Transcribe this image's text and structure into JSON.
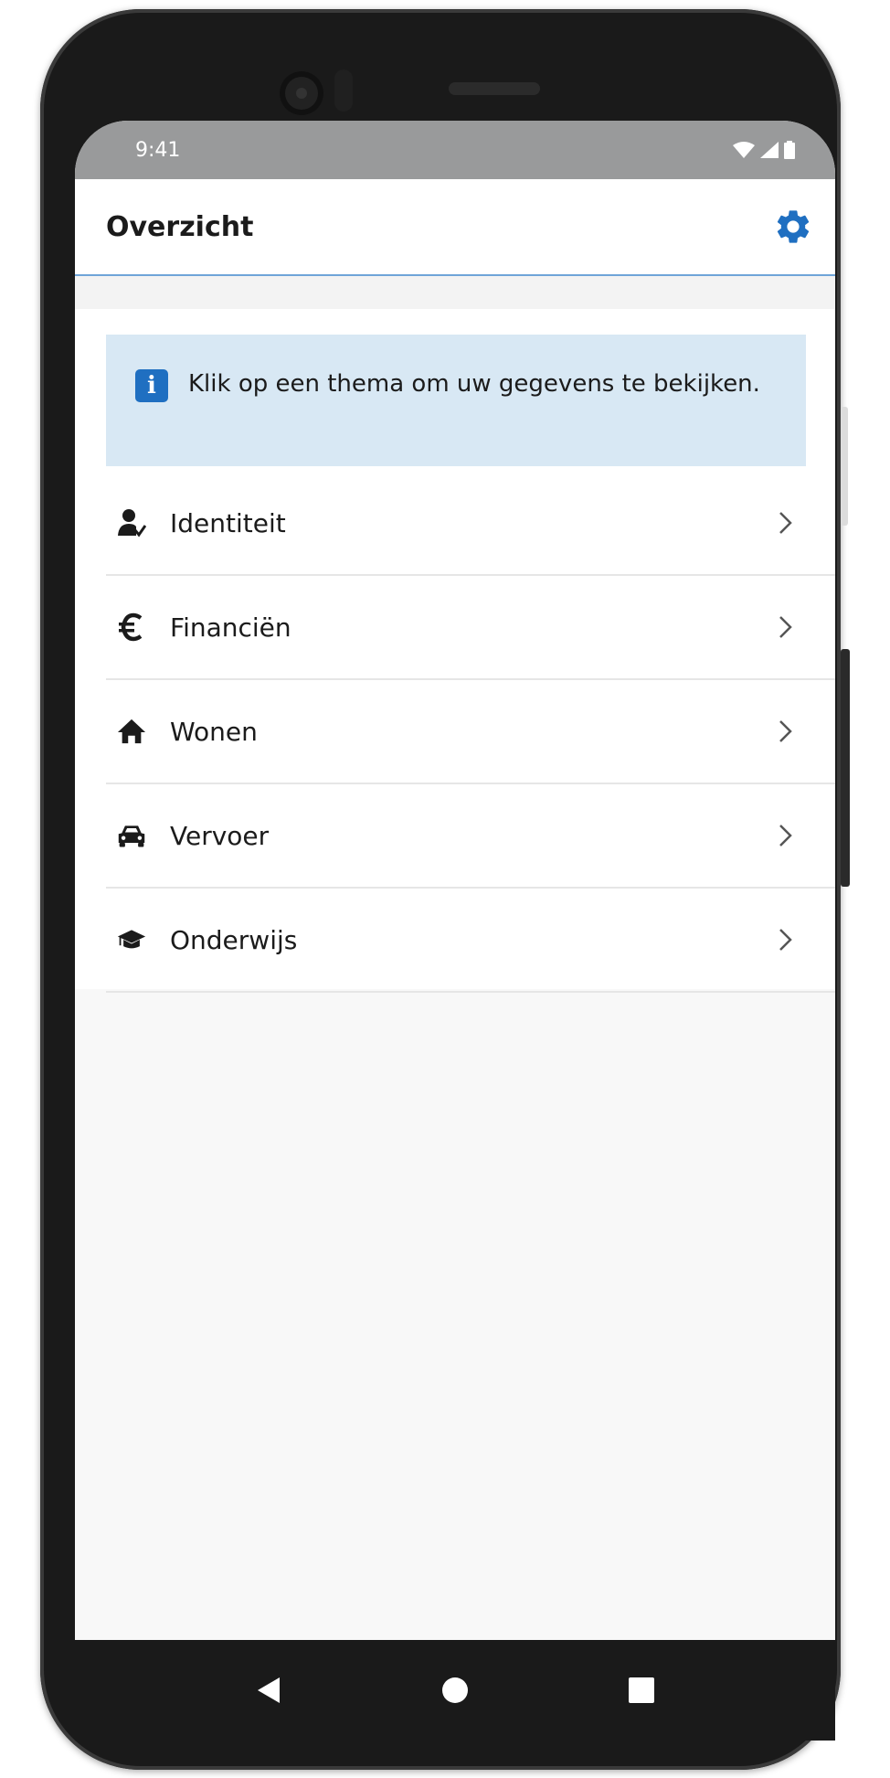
{
  "status_bar": {
    "time": "9:41"
  },
  "app_bar": {
    "title": "Overzicht",
    "settings_icon": "gear-icon"
  },
  "info": {
    "icon": "info-icon",
    "text": "Klik op een thema om uw gegevens te bekijken."
  },
  "menu": {
    "items": [
      {
        "label": "Identiteit",
        "icon": "person-check-icon"
      },
      {
        "label": "Financiën",
        "icon": "euro-icon"
      },
      {
        "label": "Wonen",
        "icon": "home-icon"
      },
      {
        "label": "Vervoer",
        "icon": "car-icon"
      },
      {
        "label": "Onderwijs",
        "icon": "graduation-cap-icon"
      }
    ]
  },
  "colors": {
    "accent": "#1f6fc1",
    "info_background": "#d8e8f4",
    "status_bar": "#999a9b",
    "divider": "#e6e6e6"
  }
}
